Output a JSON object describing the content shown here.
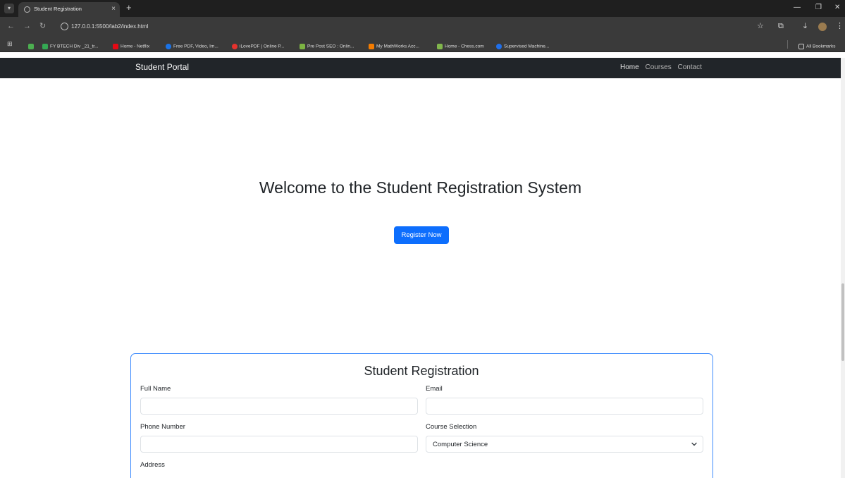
{
  "browser": {
    "tab_title": "Student Registration",
    "url": "127.0.0.1:5500/lab2/index.html",
    "bookmarks": [
      {
        "label": "FY BTECH Div _21_tr...",
        "color": "#34a853"
      },
      {
        "label": "Home - Netflix",
        "color": "#e50914"
      },
      {
        "label": "Free PDF, Video, Im...",
        "color": "#1a73e8"
      },
      {
        "label": "iLovePDF | Online P...",
        "color": "#e5322d"
      },
      {
        "label": "Pre Post SEO : Onlin...",
        "color": "#7cb342"
      },
      {
        "label": "My MathWorks Acc...",
        "color": "#f57c00"
      },
      {
        "label": "Home - Chess.com",
        "color": "#81b64c"
      },
      {
        "label": "Supervised Machine...",
        "color": "#1f6feb"
      }
    ],
    "all_bookmarks_label": "All Bookmarks"
  },
  "navbar": {
    "brand": "Student Portal",
    "links": [
      "Home",
      "Courses",
      "Contact"
    ]
  },
  "hero": {
    "title": "Welcome to the Student Registration System",
    "button_label": "Register Now"
  },
  "form": {
    "title": "Student Registration",
    "full_name_label": "Full Name",
    "full_name_value": "",
    "email_label": "Email",
    "email_value": "",
    "phone_label": "Phone Number",
    "phone_value": "",
    "course_label": "Course Selection",
    "course_value": "Computer Science",
    "address_label": "Address"
  },
  "colors": {
    "navbar_bg": "#212529",
    "primary": "#0d6efd",
    "card_border": "#3d8bfd"
  }
}
